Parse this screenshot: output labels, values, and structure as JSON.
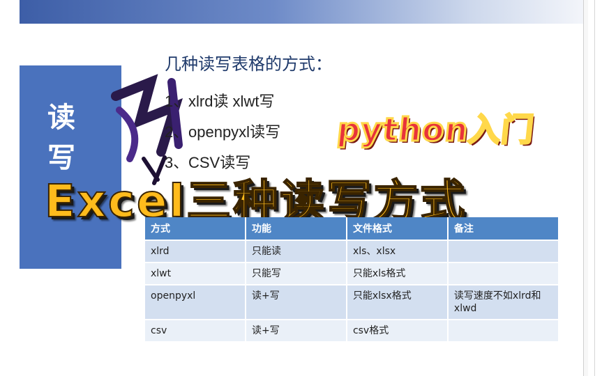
{
  "slide": {
    "side_text": [
      "读",
      "写"
    ],
    "heading": "几种读写表格的方式：",
    "list": [
      {
        "num": "1、",
        "text": "xlrd读 xlwt写"
      },
      {
        "num": "2、",
        "text": "openpyxl读写"
      },
      {
        "num": "3、",
        "text": "CSV读写"
      }
    ],
    "badge": "python入门",
    "banner": "Excel三种读写方式",
    "table": {
      "headers": [
        "方式",
        "功能",
        "文件格式",
        "备注"
      ],
      "rows": [
        [
          "xlrd",
          "只能读",
          "xls、xlsx",
          ""
        ],
        [
          "xlwt",
          "只能写",
          "只能xls格式",
          ""
        ],
        [
          "openpyxl",
          "读+写",
          "只能xlsx格式",
          "读写速度不如xlrd和xlwd"
        ],
        [
          "csv",
          "读+写",
          "csv格式",
          ""
        ]
      ]
    }
  },
  "colors": {
    "accent_blue": "#4a72bd",
    "table_header": "#4f86c6",
    "badge_red": "#e8333a",
    "banner_gold": "#ffbb1c"
  }
}
